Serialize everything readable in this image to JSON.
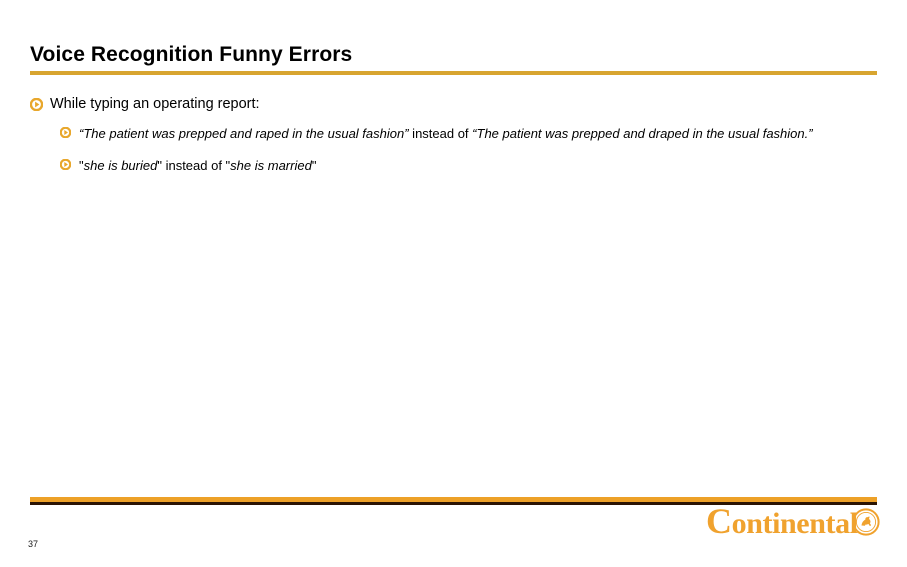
{
  "slide": {
    "title": "Voice Recognition Funny Errors",
    "page_number": "37",
    "accent_color": "#d8a530",
    "footer_bar_color": "#eda128",
    "footer_line_color": "#2b1403",
    "bullet_icon": "play-circle-icon",
    "content": {
      "level1": [
        {
          "text": "While typing an operating report:",
          "children": [
            {
              "segments": [
                {
                  "style": "italic",
                  "text": "“The patient was prepped and raped in the usual fashion”"
                },
                {
                  "style": "regular",
                  "text": " instead of "
                },
                {
                  "style": "italic",
                  "text": "“The patient was prepped and draped in the usual fashion.”"
                }
              ]
            },
            {
              "segments": [
                {
                  "style": "regular",
                  "text": "\""
                },
                {
                  "style": "italic",
                  "text": "she is buried"
                },
                {
                  "style": "regular",
                  "text": "\" instead of \""
                },
                {
                  "style": "italic",
                  "text": "she is married"
                },
                {
                  "style": "regular",
                  "text": "\""
                }
              ]
            }
          ]
        }
      ]
    }
  },
  "logo": {
    "wordmark_cap": "C",
    "wordmark_rest": "ontinental",
    "emblem": "horse-emblem-icon",
    "color": "#f0a22e"
  }
}
